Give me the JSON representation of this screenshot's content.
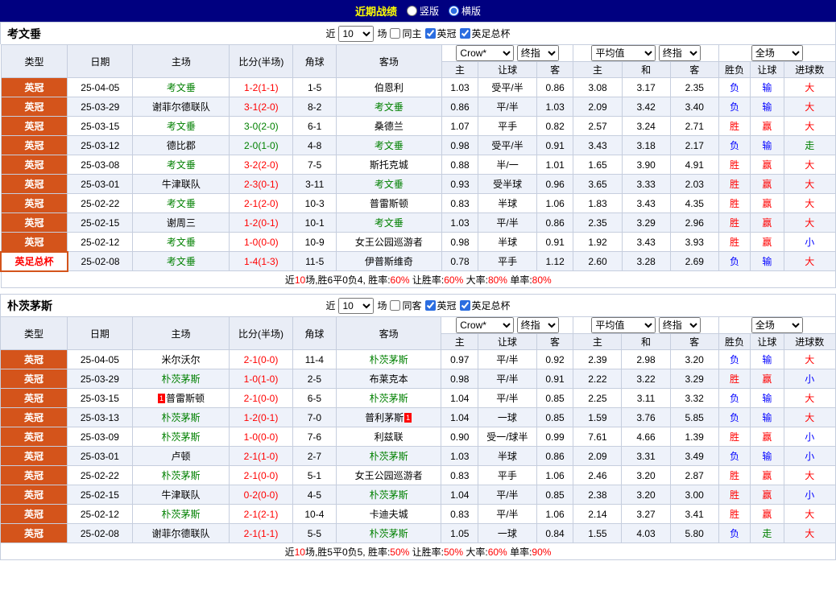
{
  "title_bar": {
    "title": "近期战绩",
    "options": [
      {
        "label": "竖版",
        "selected": false
      },
      {
        "label": "横版",
        "selected": true
      }
    ]
  },
  "columns": {
    "type": "类型",
    "date": "日期",
    "home": "主场",
    "score": "比分(半场)",
    "corner": "角球",
    "away": "客场",
    "asian_select": "Crow*",
    "asian_final": "终指",
    "euro_select": "平均值",
    "euro_final": "终指",
    "full_select": "全场",
    "sub_home": "主",
    "sub_line": "让球",
    "sub_away": "客",
    "sub_ehome": "主",
    "sub_draw": "和",
    "sub_eaway": "客",
    "sub_result": "胜负",
    "sub_let": "让球",
    "sub_goals": "进球数"
  },
  "tables": [
    {
      "team": "考文垂",
      "filter": {
        "near": "近",
        "count": "10",
        "games": "场",
        "same": "同主",
        "same_checked": false,
        "league1": "英冠",
        "league1_checked": true,
        "league2": "英足总杯",
        "league2_checked": true
      },
      "rows": [
        {
          "league": "英冠",
          "cup": false,
          "date": "25-04-05",
          "home": "考文垂",
          "score": "1-2(1-1)",
          "sc": "r",
          "corner": "1-5",
          "away": "伯恩利",
          "h": "1.03",
          "line": "受平/半",
          "a": "0.86",
          "eh": "3.08",
          "ed": "3.17",
          "ea": "2.35",
          "res": "负",
          "hcp": "输",
          "gl": "大"
        },
        {
          "league": "英冠",
          "cup": false,
          "date": "25-03-29",
          "home": "谢菲尔德联队",
          "score": "3-1(2-0)",
          "sc": "r",
          "corner": "8-2",
          "away": "考文垂",
          "h": "0.86",
          "line": "平/半",
          "a": "1.03",
          "eh": "2.09",
          "ed": "3.42",
          "ea": "3.40",
          "res": "负",
          "hcp": "输",
          "gl": "大"
        },
        {
          "league": "英冠",
          "cup": false,
          "date": "25-03-15",
          "home": "考文垂",
          "score": "3-0(2-0)",
          "sc": "g",
          "corner": "6-1",
          "away": "桑德兰",
          "h": "1.07",
          "line": "平手",
          "a": "0.82",
          "eh": "2.57",
          "ed": "3.24",
          "ea": "2.71",
          "res": "胜",
          "hcp": "赢",
          "gl": "大"
        },
        {
          "league": "英冠",
          "cup": false,
          "date": "25-03-12",
          "home": "德比郡",
          "score": "2-0(1-0)",
          "sc": "g",
          "corner": "4-8",
          "away": "考文垂",
          "h": "0.98",
          "line": "受平/半",
          "a": "0.91",
          "eh": "3.43",
          "ed": "3.18",
          "ea": "2.17",
          "res": "负",
          "hcp": "输",
          "gl": "走"
        },
        {
          "league": "英冠",
          "cup": false,
          "date": "25-03-08",
          "home": "考文垂",
          "score": "3-2(2-0)",
          "sc": "r",
          "corner": "7-5",
          "away": "斯托克城",
          "h": "0.88",
          "line": "半/一",
          "a": "1.01",
          "eh": "1.65",
          "ed": "3.90",
          "ea": "4.91",
          "res": "胜",
          "hcp": "赢",
          "gl": "大"
        },
        {
          "league": "英冠",
          "cup": false,
          "date": "25-03-01",
          "home": "牛津联队",
          "score": "2-3(0-1)",
          "sc": "r",
          "corner": "3-11",
          "away": "考文垂",
          "h": "0.93",
          "line": "受半球",
          "a": "0.96",
          "eh": "3.65",
          "ed": "3.33",
          "ea": "2.03",
          "res": "胜",
          "hcp": "赢",
          "gl": "大"
        },
        {
          "league": "英冠",
          "cup": false,
          "date": "25-02-22",
          "home": "考文垂",
          "score": "2-1(2-0)",
          "sc": "r",
          "corner": "10-3",
          "away": "普雷斯顿",
          "h": "0.83",
          "line": "半球",
          "a": "1.06",
          "eh": "1.83",
          "ed": "3.43",
          "ea": "4.35",
          "res": "胜",
          "hcp": "赢",
          "gl": "大"
        },
        {
          "league": "英冠",
          "cup": false,
          "date": "25-02-15",
          "home": "谢周三",
          "score": "1-2(0-1)",
          "sc": "r",
          "corner": "10-1",
          "away": "考文垂",
          "h": "1.03",
          "line": "平/半",
          "a": "0.86",
          "eh": "2.35",
          "ed": "3.29",
          "ea": "2.96",
          "res": "胜",
          "hcp": "赢",
          "gl": "大"
        },
        {
          "league": "英冠",
          "cup": false,
          "date": "25-02-12",
          "home": "考文垂",
          "score": "1-0(0-0)",
          "sc": "r",
          "corner": "10-9",
          "away": "女王公园巡游者",
          "h": "0.98",
          "line": "半球",
          "a": "0.91",
          "eh": "1.92",
          "ed": "3.43",
          "ea": "3.93",
          "res": "胜",
          "hcp": "赢",
          "gl": "小"
        },
        {
          "league": "英足总杯",
          "cup": true,
          "date": "25-02-08",
          "home": "考文垂",
          "score": "1-4(1-3)",
          "sc": "r",
          "corner": "11-5",
          "away": "伊普斯维奇",
          "h": "0.78",
          "line": "平手",
          "a": "1.12",
          "eh": "2.60",
          "ed": "3.28",
          "ea": "2.69",
          "res": "负",
          "hcp": "输",
          "gl": "大"
        }
      ],
      "footer": [
        [
          "近",
          ""
        ],
        [
          "10",
          "r"
        ],
        [
          "场,胜6平0负4, 胜率:",
          ""
        ],
        [
          "60%",
          "r"
        ],
        [
          " 让胜率:",
          ""
        ],
        [
          "60%",
          "r"
        ],
        [
          " 大率:",
          ""
        ],
        [
          "80%",
          "r"
        ],
        [
          " 单率:",
          ""
        ],
        [
          "80%",
          "r"
        ]
      ]
    },
    {
      "team": "朴茨茅斯",
      "filter": {
        "near": "近",
        "count": "10",
        "games": "场",
        "same": "同客",
        "same_checked": false,
        "league1": "英冠",
        "league1_checked": true,
        "league2": "英足总杯",
        "league2_checked": true
      },
      "rows": [
        {
          "league": "英冠",
          "cup": false,
          "date": "25-04-05",
          "home": "米尔沃尔",
          "score": "2-1(0-0)",
          "sc": "r",
          "corner": "11-4",
          "away": "朴茨茅斯",
          "h": "0.97",
          "line": "平/半",
          "a": "0.92",
          "eh": "2.39",
          "ed": "2.98",
          "ea": "3.20",
          "res": "负",
          "hcp": "输",
          "gl": "大"
        },
        {
          "league": "英冠",
          "cup": false,
          "date": "25-03-29",
          "home": "朴茨茅斯",
          "score": "1-0(1-0)",
          "sc": "r",
          "corner": "2-5",
          "away": "布莱克本",
          "h": "0.98",
          "line": "平/半",
          "a": "0.91",
          "eh": "2.22",
          "ed": "3.22",
          "ea": "3.29",
          "res": "胜",
          "hcp": "赢",
          "gl": "小"
        },
        {
          "league": "英冠",
          "cup": false,
          "date": "25-03-15",
          "home": "普雷斯顿",
          "home_badge_before": "1",
          "score": "2-1(0-0)",
          "sc": "r",
          "corner": "6-5",
          "away": "朴茨茅斯",
          "h": "1.04",
          "line": "平/半",
          "a": "0.85",
          "eh": "2.25",
          "ed": "3.11",
          "ea": "3.32",
          "res": "负",
          "hcp": "输",
          "gl": "大"
        },
        {
          "league": "英冠",
          "cup": false,
          "date": "25-03-13",
          "home": "朴茨茅斯",
          "score": "1-2(0-1)",
          "sc": "r",
          "corner": "7-0",
          "away": "普利茅斯",
          "away_badge_after": "1",
          "h": "1.04",
          "line": "一球",
          "a": "0.85",
          "eh": "1.59",
          "ed": "3.76",
          "ea": "5.85",
          "res": "负",
          "hcp": "输",
          "gl": "大"
        },
        {
          "league": "英冠",
          "cup": false,
          "date": "25-03-09",
          "home": "朴茨茅斯",
          "score": "1-0(0-0)",
          "sc": "r",
          "corner": "7-6",
          "away": "利兹联",
          "h": "0.90",
          "line": "受一/球半",
          "a": "0.99",
          "eh": "7.61",
          "ed": "4.66",
          "ea": "1.39",
          "res": "胜",
          "hcp": "赢",
          "gl": "小"
        },
        {
          "league": "英冠",
          "cup": false,
          "date": "25-03-01",
          "home": "卢顿",
          "score": "2-1(1-0)",
          "sc": "r",
          "corner": "2-7",
          "away": "朴茨茅斯",
          "h": "1.03",
          "line": "半球",
          "a": "0.86",
          "eh": "2.09",
          "ed": "3.31",
          "ea": "3.49",
          "res": "负",
          "hcp": "输",
          "gl": "小"
        },
        {
          "league": "英冠",
          "cup": false,
          "date": "25-02-22",
          "home": "朴茨茅斯",
          "score": "2-1(0-0)",
          "sc": "r",
          "corner": "5-1",
          "away": "女王公园巡游者",
          "h": "0.83",
          "line": "平手",
          "a": "1.06",
          "eh": "2.46",
          "ed": "3.20",
          "ea": "2.87",
          "res": "胜",
          "hcp": "赢",
          "gl": "大"
        },
        {
          "league": "英冠",
          "cup": false,
          "date": "25-02-15",
          "home": "牛津联队",
          "score": "0-2(0-0)",
          "sc": "r",
          "corner": "4-5",
          "away": "朴茨茅斯",
          "h": "1.04",
          "line": "平/半",
          "a": "0.85",
          "eh": "2.38",
          "ed": "3.20",
          "ea": "3.00",
          "res": "胜",
          "hcp": "赢",
          "gl": "小"
        },
        {
          "league": "英冠",
          "cup": false,
          "date": "25-02-12",
          "home": "朴茨茅斯",
          "score": "2-1(2-1)",
          "sc": "r",
          "corner": "10-4",
          "away": "卡迪夫城",
          "h": "0.83",
          "line": "平/半",
          "a": "1.06",
          "eh": "2.14",
          "ed": "3.27",
          "ea": "3.41",
          "res": "胜",
          "hcp": "赢",
          "gl": "大"
        },
        {
          "league": "英冠",
          "cup": false,
          "date": "25-02-08",
          "home": "谢菲尔德联队",
          "score": "2-1(1-1)",
          "sc": "r",
          "corner": "5-5",
          "away": "朴茨茅斯",
          "h": "1.05",
          "line": "一球",
          "a": "0.84",
          "eh": "1.55",
          "ed": "4.03",
          "ea": "5.80",
          "res": "负",
          "hcp": "走",
          "gl": "大"
        }
      ],
      "footer": [
        [
          "近",
          ""
        ],
        [
          "10",
          "r"
        ],
        [
          "场,胜5平0负5, 胜率:",
          ""
        ],
        [
          "50%",
          "r"
        ],
        [
          " 让胜率:",
          ""
        ],
        [
          "50%",
          "r"
        ],
        [
          " 大率:",
          ""
        ],
        [
          "60%",
          "r"
        ],
        [
          " 单率:",
          ""
        ],
        [
          "90%",
          "r"
        ]
      ]
    }
  ]
}
